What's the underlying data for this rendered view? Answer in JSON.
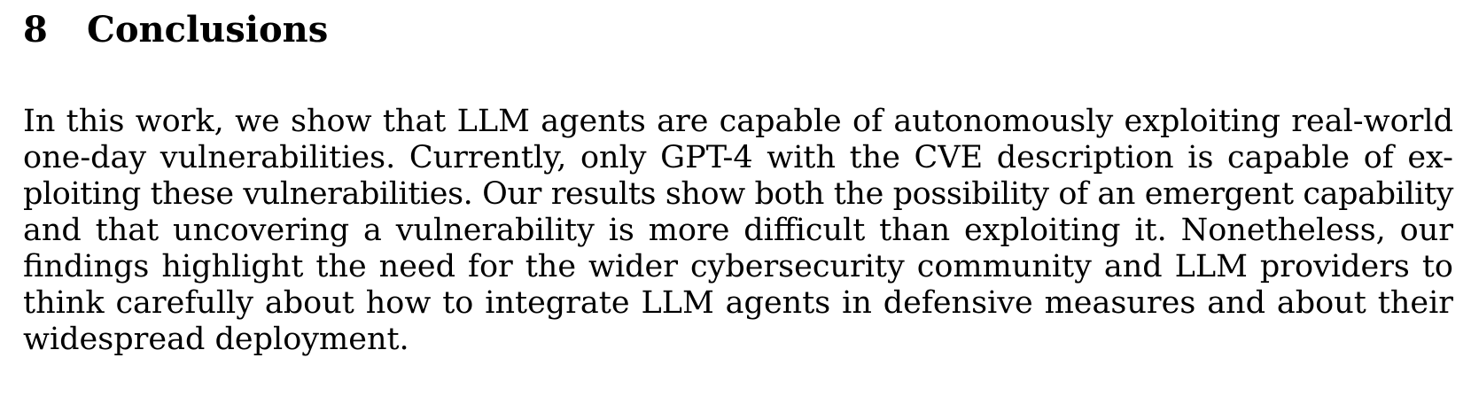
{
  "section": {
    "number": "8",
    "title": "Conclusions"
  },
  "paragraph": {
    "lines": [
      "In this work, we show that LLM agents are capable of autonomously exploiting real-world",
      "one-day vulnerabilities. Currently, only GPT-4 with the CVE description is capable of ex-",
      "ploiting these vulnerabilities. Our results show both the possibility of an emergent capability",
      "and that uncovering a vulnerability is more difficult than exploiting it. Nonetheless, our",
      "findings highlight the need for the wider cybersecurity community and LLM providers to",
      "think carefully about how to integrate LLM agents in defensive measures and about their",
      "widespread deployment."
    ]
  }
}
